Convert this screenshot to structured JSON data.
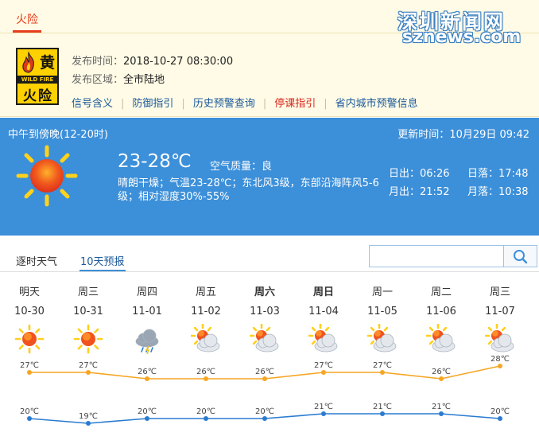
{
  "warning": {
    "tab_label": "火险",
    "badge": {
      "level": "黄",
      "en": "WILD FIRE",
      "name": "火险"
    },
    "publish_time_label": "发布时间：",
    "publish_time": "2018-10-27 08:30:00",
    "area_label": "发布区域：",
    "area": "全市陆地",
    "links": [
      {
        "label": "信号含义",
        "highlight": false
      },
      {
        "label": "防御指引",
        "highlight": false
      },
      {
        "label": "历史预警查询",
        "highlight": false
      },
      {
        "label": "停课指引",
        "highlight": true
      },
      {
        "label": "省内城市预警信息",
        "highlight": false
      }
    ]
  },
  "watermark": {
    "cn": "深圳新闻网",
    "en": "sznews.com"
  },
  "current": {
    "period": "中午到傍晚(12-20时)",
    "update_label": "更新时间：",
    "update_time": "10月29日 09:42",
    "icon": "sunny-icon",
    "temp_range": "23-28℃",
    "air_quality_label": "空气质量：",
    "air_quality": "良",
    "description": "晴朗干燥；气温23-28℃；东北风3级，东部沿海阵风5-6级；相对湿度30%-55%",
    "sunrise_label": "日出：",
    "sunrise": "06:26",
    "sunset_label": "日落：",
    "sunset": "17:48",
    "moonrise_label": "月出：",
    "moonrise": "21:52",
    "moonset_label": "月落：",
    "moonset": "10:38"
  },
  "tabs": [
    {
      "label": "逐时天气",
      "active": false
    },
    {
      "label": "10天预报",
      "active": true
    }
  ],
  "search": {
    "placeholder": ""
  },
  "colors": {
    "high_line": "#f5a623",
    "low_line": "#2a7bd0",
    "accent": "#3c8fd9",
    "warn_red": "#e63c1e"
  },
  "forecast": [
    {
      "weekday": "明天",
      "date": "10-30",
      "icon": "sunny-icon",
      "high": 27,
      "low": 20,
      "high_label": "27℃",
      "low_label": "20℃",
      "bold": false
    },
    {
      "weekday": "周三",
      "date": "10-31",
      "icon": "sunny-icon",
      "high": 27,
      "low": 19,
      "high_label": "27℃",
      "low_label": "19℃",
      "bold": false
    },
    {
      "weekday": "周四",
      "date": "11-01",
      "icon": "rain-cloud-icon",
      "high": 26,
      "low": 20,
      "high_label": "26℃",
      "low_label": "20℃",
      "bold": false
    },
    {
      "weekday": "周五",
      "date": "11-02",
      "icon": "partly-cloudy-icon",
      "high": 26,
      "low": 20,
      "high_label": "26℃",
      "low_label": "20℃",
      "bold": false
    },
    {
      "weekday": "周六",
      "date": "11-03",
      "icon": "partly-cloudy-icon",
      "high": 26,
      "low": 20,
      "high_label": "26℃",
      "low_label": "20℃",
      "bold": true
    },
    {
      "weekday": "周日",
      "date": "11-04",
      "icon": "partly-cloudy-icon",
      "high": 27,
      "low": 21,
      "high_label": "27℃",
      "low_label": "21℃",
      "bold": true
    },
    {
      "weekday": "周一",
      "date": "11-05",
      "icon": "partly-cloudy-icon",
      "high": 27,
      "low": 21,
      "high_label": "27℃",
      "low_label": "21℃",
      "bold": false
    },
    {
      "weekday": "周二",
      "date": "11-06",
      "icon": "partly-cloudy-icon",
      "high": 26,
      "low": 21,
      "high_label": "26℃",
      "low_label": "21℃",
      "bold": false
    },
    {
      "weekday": "周三",
      "date": "11-07",
      "icon": "partly-cloudy-icon",
      "high": 28,
      "low": 20,
      "high_label": "28℃",
      "low_label": "20℃",
      "bold": false
    }
  ]
}
